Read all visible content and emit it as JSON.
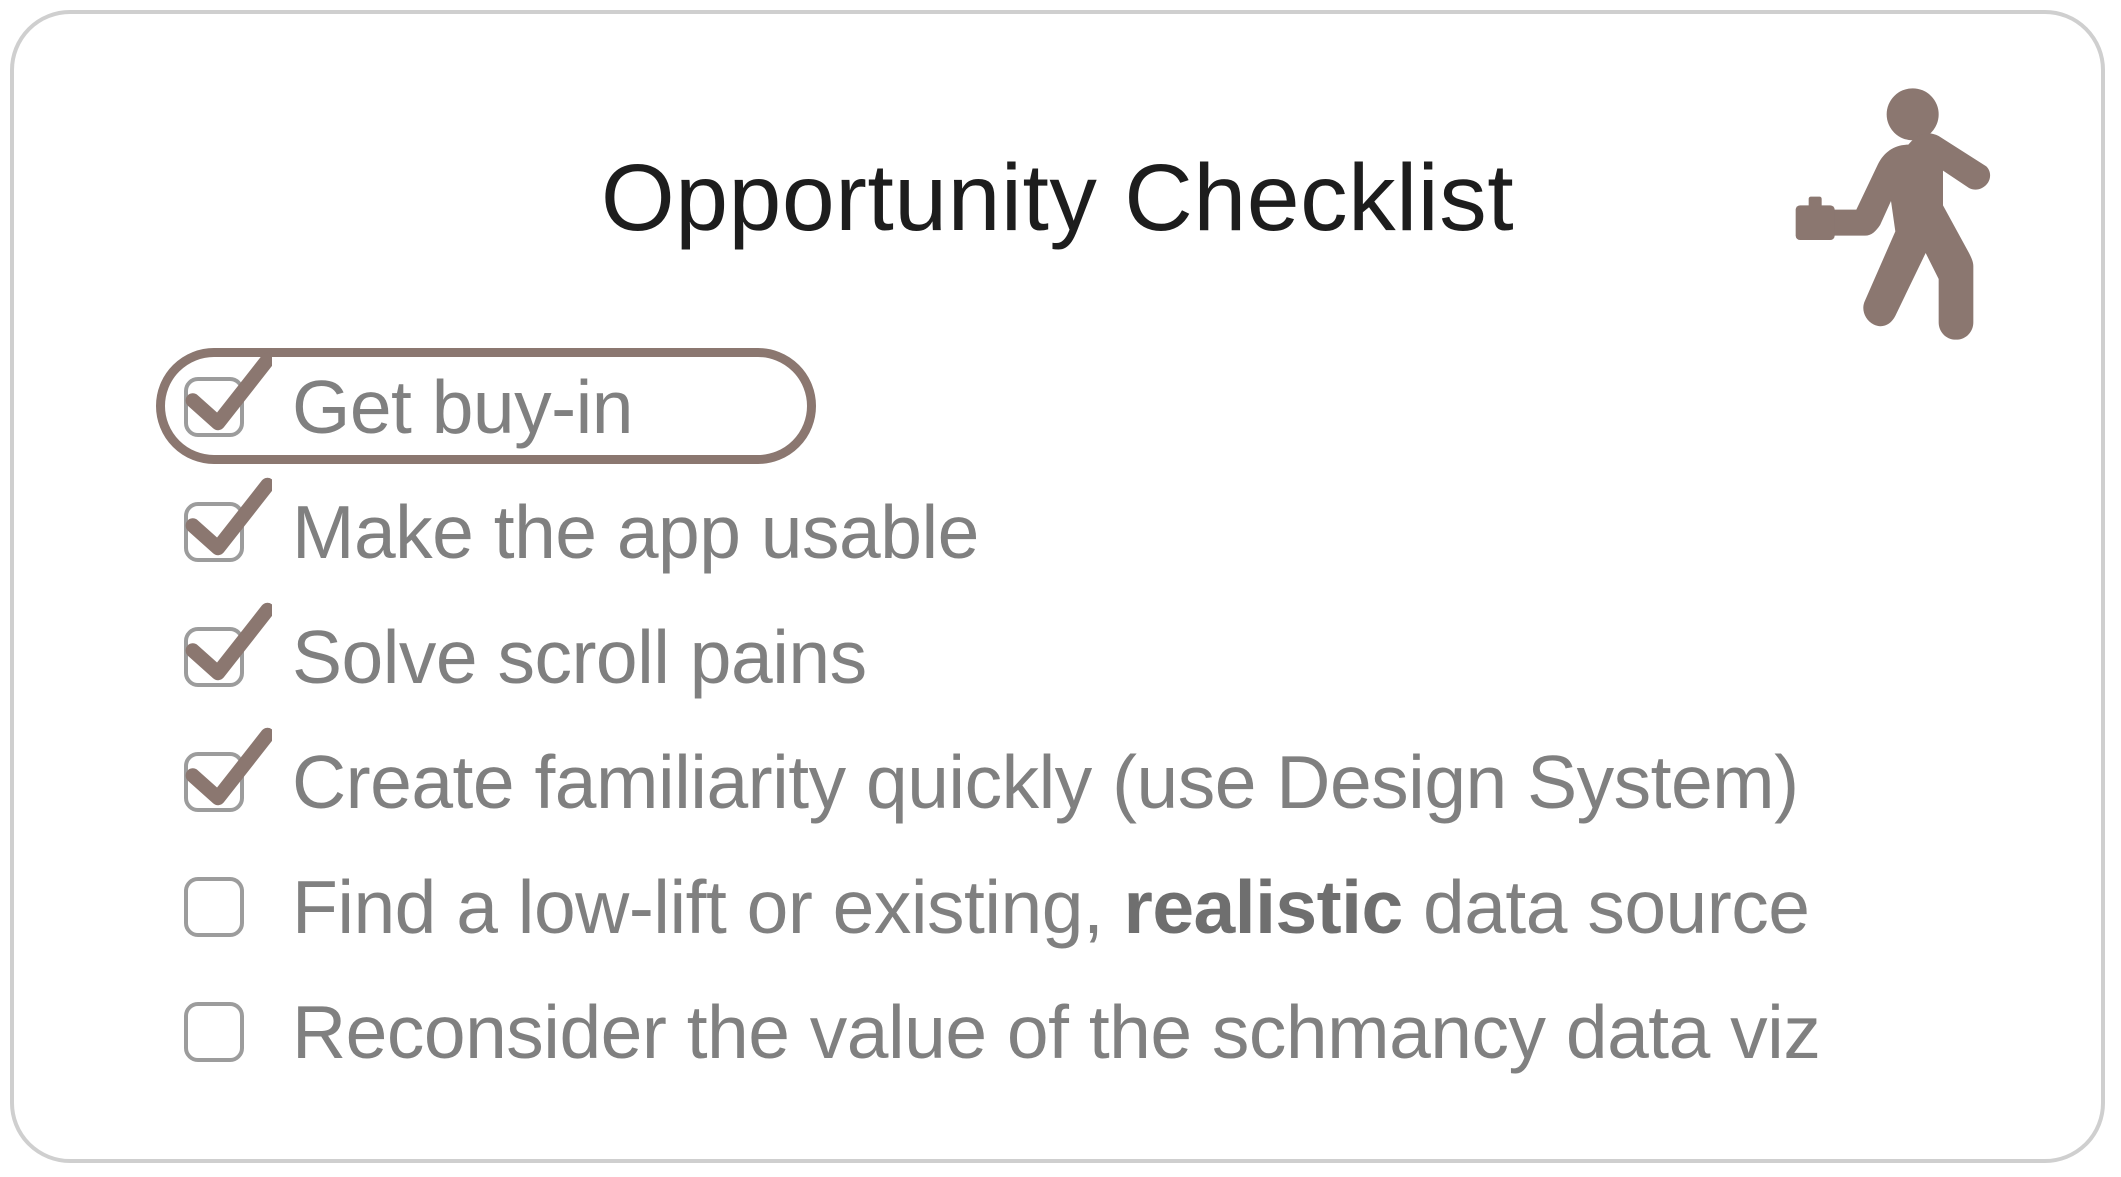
{
  "title": "Opportunity Checklist",
  "accent_color": "#8b7770",
  "text_color": "#808080",
  "items": [
    {
      "label": "Get buy-in",
      "checked": true,
      "circled": true
    },
    {
      "label": "Make the app usable",
      "checked": true,
      "circled": false
    },
    {
      "label": "Solve scroll pains",
      "checked": true,
      "circled": false
    },
    {
      "label": "Create familiarity quickly (use Design System)",
      "checked": true,
      "circled": false
    },
    {
      "label_html": "Find a low-lift or existing, <strong>realistic</strong> data source",
      "label": "Find a low-lift or existing, realistic data source",
      "checked": false,
      "circled": false
    },
    {
      "label": "Reconsider the value of the schmancy data viz",
      "checked": false,
      "circled": false
    }
  ]
}
